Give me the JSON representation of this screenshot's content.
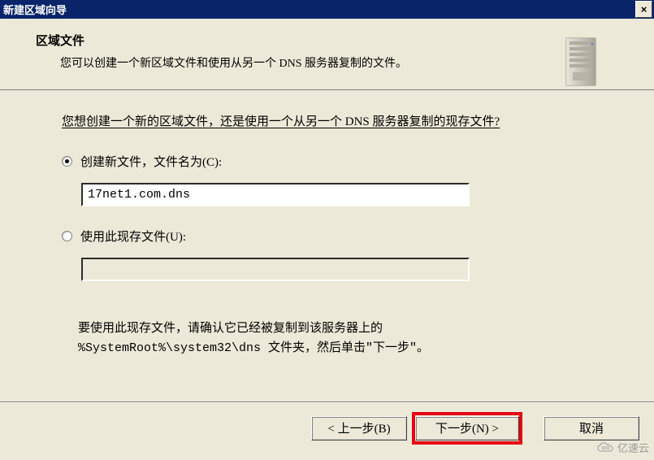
{
  "titlebar": {
    "title": "新建区域向导",
    "close_icon": "×"
  },
  "header": {
    "title": "区域文件",
    "subtitle": "您可以创建一个新区域文件和使用从另一个 DNS 服务器复制的文件。"
  },
  "content": {
    "question": "您想创建一个新的区域文件，还是使用一个从另一个 DNS 服务器复制的现存文件?",
    "option_create": {
      "label": "创建新文件，文件名为(C):",
      "value": "17net1.com.dns",
      "checked": true
    },
    "option_existing": {
      "label": "使用此现存文件(U):",
      "value": "",
      "checked": false
    },
    "note_line1": "要使用此现存文件，请确认它已经被复制到该服务器上的",
    "note_line2": "%SystemRoot%\\system32\\dns 文件夹，然后单击\"下一步\"。"
  },
  "buttons": {
    "back": "< 上一步(B)",
    "next": "下一步(N) >",
    "cancel": "取消"
  },
  "watermark": {
    "text": "亿速云"
  }
}
